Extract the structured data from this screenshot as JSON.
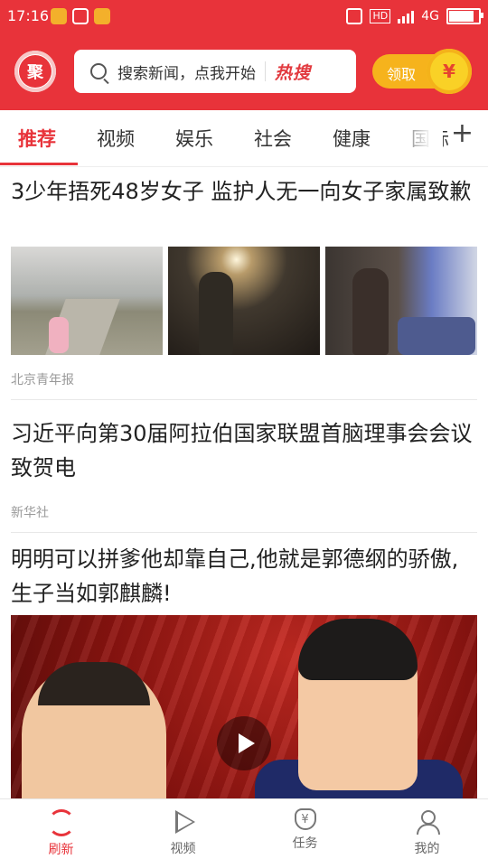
{
  "status_bar": {
    "time": "17:16",
    "network": "4G"
  },
  "header": {
    "logo_text": "聚",
    "search_placeholder": "搜索新闻，点我开始",
    "hot_search_label": "热搜",
    "reward_label": "领取",
    "coin_symbol": "¥"
  },
  "tabs": [
    "推荐",
    "视频",
    "娱乐",
    "社会",
    "健康",
    "国际"
  ],
  "articles": [
    {
      "title": "3少年捂死48岁女子 监护人无一向女子家属致歉",
      "source": "北京青年报"
    },
    {
      "title": "习近平向第30届阿拉伯国家联盟首脑理事会会议致贺电",
      "source": "新华社"
    },
    {
      "title": "明明可以拼爹他却靠自己,他就是郭德纲的骄傲,生子当如郭麒麟!"
    }
  ],
  "bottom_nav": [
    "刷新",
    "视频",
    "任务",
    "我的"
  ],
  "colors": {
    "brand_red": "#e8333a",
    "gold": "#f6b31c"
  },
  "icons": [
    "search-icon",
    "plus-icon",
    "play-icon",
    "refresh-icon",
    "video-icon",
    "task-icon",
    "user-icon"
  ]
}
